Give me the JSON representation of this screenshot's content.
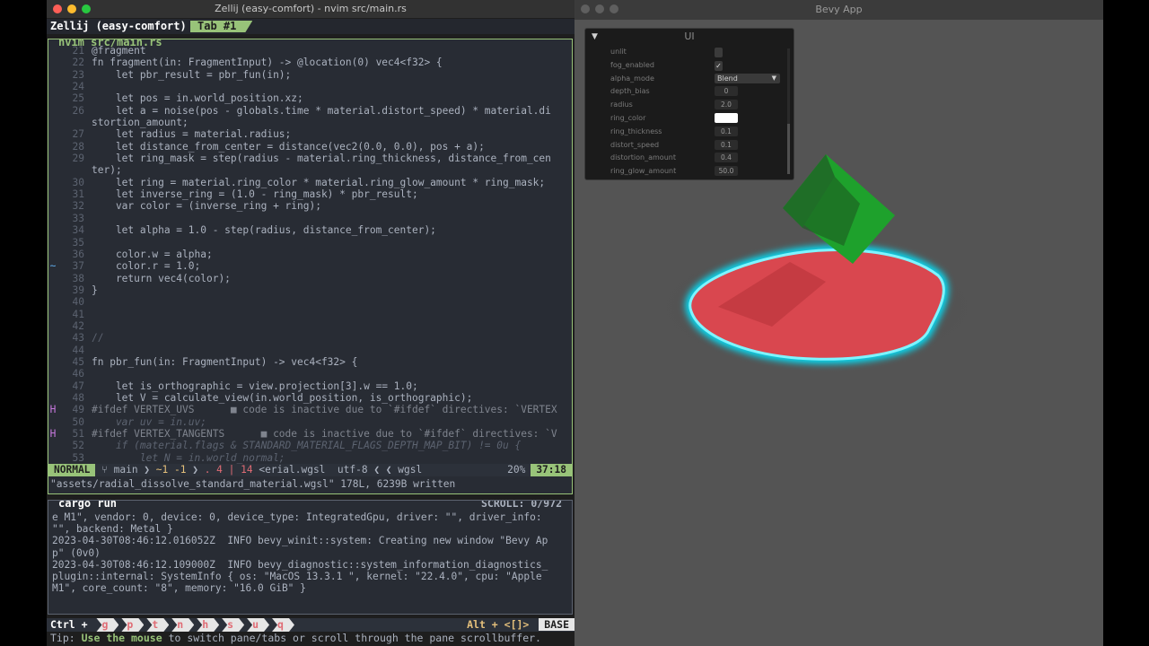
{
  "terminal": {
    "window_title": "Zellij (easy-comfort) - nvim src/main.rs",
    "session": "Zellij (easy-comfort)",
    "active_tab": "Tab #1",
    "editor_pane_title": "nvim src/main.rs",
    "code_lines": [
      {
        "n": "21",
        "gutter": "",
        "text": "@fragment"
      },
      {
        "n": "22",
        "gutter": "",
        "text": "fn fragment(in: FragmentInput) -> @location(0) vec4<f32> {"
      },
      {
        "n": "23",
        "gutter": "",
        "text": "    let pbr_result = pbr_fun(in);"
      },
      {
        "n": "24",
        "gutter": "",
        "text": ""
      },
      {
        "n": "25",
        "gutter": "",
        "text": "    let pos = in.world_position.xz;"
      },
      {
        "n": "26",
        "gutter": "",
        "text": "    let a = noise(pos - globals.time * material.distort_speed) * material.di"
      },
      {
        "n": "",
        "gutter": "",
        "text": "stortion_amount;"
      },
      {
        "n": "27",
        "gutter": "",
        "text": "    let radius = material.radius;"
      },
      {
        "n": "28",
        "gutter": "",
        "text": "    let distance_from_center = distance(vec2(0.0, 0.0), pos + a);"
      },
      {
        "n": "29",
        "gutter": "",
        "text": "    let ring_mask = step(radius - material.ring_thickness, distance_from_cen"
      },
      {
        "n": "",
        "gutter": "",
        "text": "ter);"
      },
      {
        "n": "30",
        "gutter": "",
        "text": "    let ring = material.ring_color * material.ring_glow_amount * ring_mask;"
      },
      {
        "n": "31",
        "gutter": "",
        "text": "    let inverse_ring = (1.0 - ring_mask) * pbr_result;"
      },
      {
        "n": "32",
        "gutter": "",
        "text": "    var color = (inverse_ring + ring);"
      },
      {
        "n": "33",
        "gutter": "",
        "text": ""
      },
      {
        "n": "34",
        "gutter": "",
        "text": "    let alpha = 1.0 - step(radius, distance_from_center);"
      },
      {
        "n": "35",
        "gutter": "",
        "text": ""
      },
      {
        "n": "36",
        "gutter": "",
        "text": "    color.w = alpha;"
      },
      {
        "n": "37",
        "gutter": "~",
        "text": "    color.r = 1.0;"
      },
      {
        "n": "38",
        "gutter": "",
        "text": "    return vec4(color);"
      },
      {
        "n": "39",
        "gutter": "",
        "text": "}"
      },
      {
        "n": "40",
        "gutter": "",
        "text": ""
      },
      {
        "n": "41",
        "gutter": "",
        "text": ""
      },
      {
        "n": "42",
        "gutter": "",
        "text": ""
      },
      {
        "n": "43",
        "gutter": "",
        "text": "//"
      },
      {
        "n": "44",
        "gutter": "",
        "text": ""
      },
      {
        "n": "45",
        "gutter": "",
        "text": "fn pbr_fun(in: FragmentInput) -> vec4<f32> {"
      },
      {
        "n": "46",
        "gutter": "",
        "text": ""
      },
      {
        "n": "47",
        "gutter": "",
        "text": "    let is_orthographic = view.projection[3].w == 1.0;"
      },
      {
        "n": "48",
        "gutter": "",
        "text": "    let V = calculate_view(in.world_position, is_orthographic);"
      },
      {
        "n": "49",
        "gutter": "H",
        "text": "#ifdef VERTEX_UVS      ■ code is inactive due to `#ifdef` directives: `VERTEX"
      },
      {
        "n": "50",
        "gutter": "",
        "text": "    var uv = in.uv;"
      },
      {
        "n": "51",
        "gutter": "H",
        "text": "#ifdef VERTEX_TANGENTS      ■ code is inactive due to `#ifdef` directives: `V"
      },
      {
        "n": "52",
        "gutter": "",
        "text": "    if (material.flags & STANDARD_MATERIAL_FLAGS_DEPTH_MAP_BIT) != 0u {"
      },
      {
        "n": "53",
        "gutter": "",
        "text": "        let N = in.world_normal;"
      }
    ],
    "status": {
      "mode": "NORMAL",
      "branch": "main",
      "diff": "~1 -1",
      "diag": ". 4 | 14",
      "file": "<erial.wgsl",
      "encoding": "utf-8",
      "filetype": "wgsl",
      "percent": "20%",
      "position": "37:18"
    },
    "message": "\"assets/radial_dissolve_standard_material.wgsl\" 178L, 6239B written",
    "cargo_title": "cargo run",
    "scroll": "SCROLL:  0/972",
    "log_lines": [
      "e M1\", vendor: 0, device: 0, device_type: IntegratedGpu, driver: \"\", driver_info:",
      "\"\", backend: Metal }",
      "2023-04-30T08:46:12.016052Z  INFO bevy_winit::system: Creating new window \"Bevy Ap",
      "p\" (0v0)",
      "2023-04-30T08:46:12.109000Z  INFO bevy_diagnostic::system_information_diagnostics_",
      "plugin::internal: SystemInfo { os: \"MacOS 13.3.1 \", kernel: \"22.4.0\", cpu: \"Apple",
      "M1\", core_count: \"8\", memory: \"16.0 GiB\" }"
    ],
    "keybar": {
      "ctrl": "Ctrl +",
      "keys": [
        "g",
        "p",
        "t",
        "n",
        "h",
        "s",
        "u",
        "q"
      ],
      "alt": "Alt + <[]>",
      "mode": "BASE"
    },
    "tip": {
      "prefix": "Tip: ",
      "highlight": "Use the mouse",
      "rest": " to switch pane/tabs or scroll through the pane scrollbuffer."
    }
  },
  "bevy": {
    "title": "Bevy App",
    "panel_title": "UI",
    "fields": [
      {
        "label": "unlit",
        "kind": "checkbox",
        "value": ""
      },
      {
        "label": "fog_enabled",
        "kind": "checkbox",
        "value": "✓"
      },
      {
        "label": "alpha_mode",
        "kind": "select",
        "value": "Blend"
      },
      {
        "label": "depth_bias",
        "kind": "number",
        "value": "0"
      },
      {
        "label": "radius",
        "kind": "number",
        "value": "2.0"
      },
      {
        "label": "ring_color",
        "kind": "color",
        "value": ""
      },
      {
        "label": "ring_thickness",
        "kind": "number",
        "value": "0.1"
      },
      {
        "label": "distort_speed",
        "kind": "number",
        "value": "0.1"
      },
      {
        "label": "distortion_amount",
        "kind": "number",
        "value": "0.4"
      },
      {
        "label": "ring_glow_amount",
        "kind": "number",
        "value": "50.0"
      }
    ]
  }
}
